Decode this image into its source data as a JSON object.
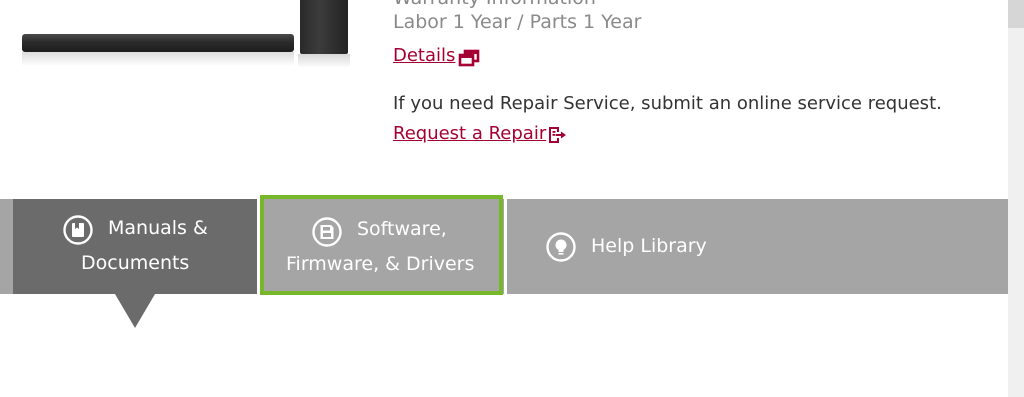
{
  "warranty": {
    "heading": "Warranty Information",
    "coverage": "Labor 1 Year / Parts 1 Year",
    "details_link": "Details",
    "repair_text": "If you need Repair Service, submit an online service request.",
    "repair_link": "Request a Repair"
  },
  "tabs": [
    {
      "line1": "Manuals &",
      "line2": "Documents",
      "icon": "book-icon",
      "active": true
    },
    {
      "line1": "Software,",
      "line2": "Firmware, & Drivers",
      "icon": "floppy-disk-icon",
      "active": false,
      "highlighted": true
    },
    {
      "line1": "Help Library",
      "icon": "lightbulb-icon",
      "active": false
    }
  ],
  "colors": {
    "link": "#a50034",
    "active_tab": "#6b6b6b",
    "inactive_tab": "#a5a5a5",
    "highlight_border": "#76b82a",
    "secondary_text": "#8a8a8a"
  }
}
